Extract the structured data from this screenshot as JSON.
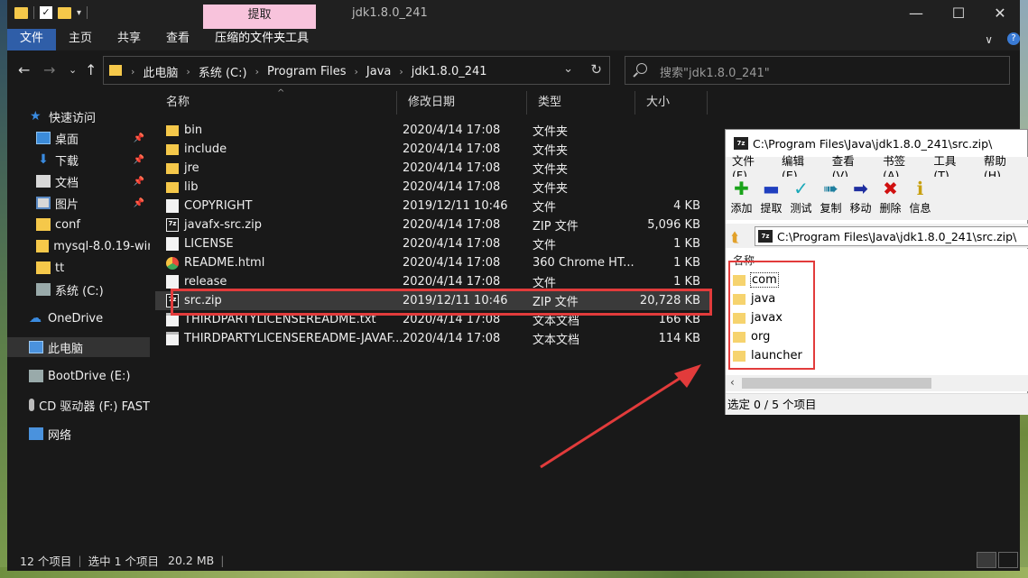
{
  "titlebar": {
    "extract_tab": "提取",
    "title": "jdk1.8.0_241"
  },
  "ribbon": {
    "tabs": [
      "文件",
      "主页",
      "共享",
      "查看",
      "压缩的文件夹工具"
    ]
  },
  "address": {
    "crumbs": [
      "此电脑",
      "系统 (C:)",
      "Program Files",
      "Java",
      "jdk1.8.0_241"
    ]
  },
  "search": {
    "placeholder": "搜索\"jdk1.8.0_241\""
  },
  "sidebar": {
    "items": [
      {
        "label": "快速访问",
        "icon": "star-icon"
      },
      {
        "label": "桌面",
        "icon": "desktop-icon"
      },
      {
        "label": "下载",
        "icon": "download-icon"
      },
      {
        "label": "文档",
        "icon": "document-icon"
      },
      {
        "label": "图片",
        "icon": "pictures-icon"
      },
      {
        "label": "conf",
        "icon": "folder-icon"
      },
      {
        "label": "mysql-8.0.19-winx",
        "icon": "folder-icon"
      },
      {
        "label": "tt",
        "icon": "folder-icon"
      },
      {
        "label": "系统 (C:)",
        "icon": "drive-icon"
      },
      {
        "label": "OneDrive",
        "icon": "cloud-icon"
      },
      {
        "label": "此电脑",
        "icon": "computer-icon"
      },
      {
        "label": "BootDrive (E:)",
        "icon": "drive-icon"
      },
      {
        "label": "CD 驱动器 (F:) FAST",
        "icon": "cd-drive-icon"
      },
      {
        "label": "网络",
        "icon": "network-icon"
      }
    ]
  },
  "columns": {
    "name": "名称",
    "date": "修改日期",
    "type": "类型",
    "size": "大小"
  },
  "files": [
    {
      "name": "bin",
      "date": "2020/4/14 17:08",
      "type": "文件夹",
      "size": "",
      "icon": "folder"
    },
    {
      "name": "include",
      "date": "2020/4/14 17:08",
      "type": "文件夹",
      "size": "",
      "icon": "folder"
    },
    {
      "name": "jre",
      "date": "2020/4/14 17:08",
      "type": "文件夹",
      "size": "",
      "icon": "folder"
    },
    {
      "name": "lib",
      "date": "2020/4/14 17:08",
      "type": "文件夹",
      "size": "",
      "icon": "folder"
    },
    {
      "name": "COPYRIGHT",
      "date": "2019/12/11 10:46",
      "type": "文件",
      "size": "4 KB",
      "icon": "file"
    },
    {
      "name": "javafx-src.zip",
      "date": "2020/4/14 17:08",
      "type": "ZIP 文件",
      "size": "5,096 KB",
      "icon": "zip7"
    },
    {
      "name": "LICENSE",
      "date": "2020/4/14 17:08",
      "type": "文件",
      "size": "1 KB",
      "icon": "file"
    },
    {
      "name": "README.html",
      "date": "2020/4/14 17:08",
      "type": "360 Chrome HT...",
      "size": "1 KB",
      "icon": "chrome"
    },
    {
      "name": "release",
      "date": "2020/4/14 17:08",
      "type": "文件",
      "size": "1 KB",
      "icon": "file"
    },
    {
      "name": "src.zip",
      "date": "2019/12/11 10:46",
      "type": "ZIP 文件",
      "size": "20,728 KB",
      "icon": "zip7"
    },
    {
      "name": "THIRDPARTYLICENSEREADME.txt",
      "date": "2020/4/14 17:08",
      "type": "文本文档",
      "size": "166 KB",
      "icon": "txt"
    },
    {
      "name": "THIRDPARTYLICENSEREADME-JAVAF...",
      "date": "2020/4/14 17:08",
      "type": "文本文档",
      "size": "114 KB",
      "icon": "txt"
    }
  ],
  "status": {
    "count": "12 个项目",
    "selected": "选中 1 个项目",
    "size": "20.2 MB"
  },
  "zip": {
    "title": "C:\\Program Files\\Java\\jdk1.8.0_241\\src.zip\\",
    "menu": [
      "文件(F)",
      "编辑(E)",
      "查看(V)",
      "书签(A)",
      "工具(T)",
      "帮助(H)"
    ],
    "tools": [
      {
        "label": "添加",
        "icon": "add-icon",
        "color": "#1aa31a"
      },
      {
        "label": "提取",
        "icon": "extract-icon",
        "color": "#1f3fbf"
      },
      {
        "label": "测试",
        "icon": "test-icon",
        "color": "#1aa8b8"
      },
      {
        "label": "复制",
        "icon": "copy-icon",
        "color": "#1f7f9f"
      },
      {
        "label": "移动",
        "icon": "move-icon",
        "color": "#1f2fa0"
      },
      {
        "label": "删除",
        "icon": "delete-icon",
        "color": "#d01010"
      },
      {
        "label": "信息",
        "icon": "info-icon",
        "color": "#c8a010"
      }
    ],
    "path": "C:\\Program Files\\Java\\jdk1.8.0_241\\src.zip\\",
    "list_header": "名称",
    "items": [
      "com",
      "java",
      "javax",
      "org",
      "launcher"
    ],
    "status": "选定 0 / 5 个项目"
  },
  "colors": {
    "highlight": "#e23b3b",
    "ribbon_active": "#2f5ea8",
    "extract_tab": "#f8c3dc"
  }
}
